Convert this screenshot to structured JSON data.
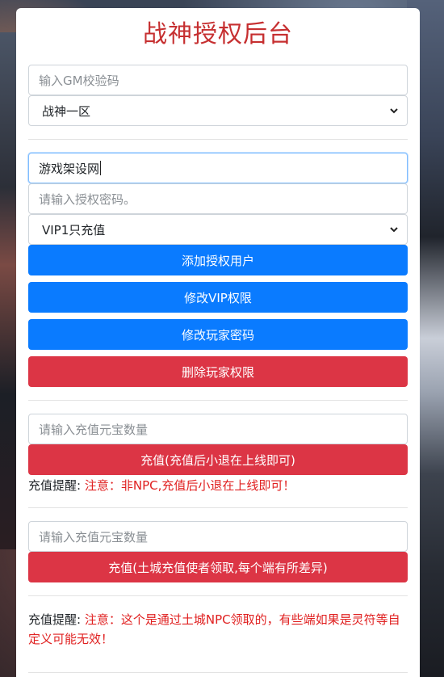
{
  "title": "战神授权后台",
  "gm": {
    "placeholder": "输入GM校验码"
  },
  "server": {
    "selected": "战神一区"
  },
  "username": {
    "value": "游戏架设网"
  },
  "password": {
    "placeholder": "请输入授权密码。"
  },
  "vip": {
    "selected": "VIP1只充值"
  },
  "buttons": {
    "add": "添加授权用户",
    "modify_vip": "修改VIP权限",
    "modify_password": "修改玩家密码",
    "delete": "删除玩家权限"
  },
  "recharge1": {
    "placeholder": "请输入充值元宝数量",
    "button": "充值(充值后小退在上线即可)",
    "tip_label": "充值提醒:",
    "tip_text": "注意：非NPC,充值后小退在上线即可！"
  },
  "recharge2": {
    "placeholder": "请输入充值元宝数量",
    "button": "充值(土城充值使者领取,每个端有所差异)",
    "tip_label": "充值提醒:",
    "tip_text": "注意：这个是通过土城NPC领取的，有些端如果是灵符等自定义可能无效！"
  },
  "colors": {
    "title": "#c62f30",
    "primary": "#0a7bff",
    "danger": "#dc3545",
    "warn": "#e02020"
  },
  "icons": {
    "select_caret": "chevron-down-icon"
  }
}
